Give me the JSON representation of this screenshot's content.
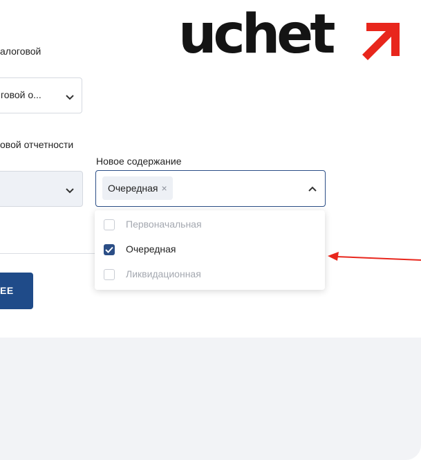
{
  "logo": {
    "text": "uchet",
    "accent_color": "#e8261c"
  },
  "form": {
    "label_1": "алоговой",
    "select_1_value": "говой о...",
    "label_2": "овой отчетности",
    "new_content_label": "Новое содержание",
    "selected_chip": "Очередная",
    "chip_remove": "×",
    "options": [
      {
        "label": "Первоначальная",
        "checked": false
      },
      {
        "label": "Очередная",
        "checked": true
      },
      {
        "label": "Ликвидационная",
        "checked": false
      }
    ],
    "button_label": "EE"
  },
  "colors": {
    "primary": "#1f4b89",
    "border_active": "#2b4e86",
    "arrow": "#e8261c"
  }
}
